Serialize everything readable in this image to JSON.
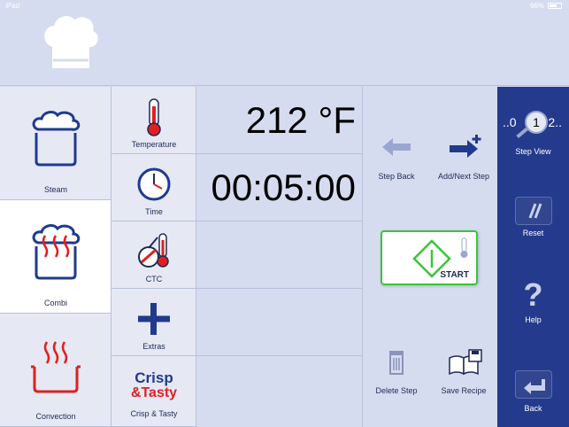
{
  "status": {
    "carrier": "iPad",
    "time": "",
    "battery": "66%"
  },
  "header": {
    "icon": "chef-hat-icon"
  },
  "modes": [
    {
      "label": "Steam",
      "icon": "steam-pot-icon",
      "active": false
    },
    {
      "label": "Combi",
      "icon": "combi-pot-icon",
      "active": true
    },
    {
      "label": "Convection",
      "icon": "convection-pot-icon",
      "active": false
    }
  ],
  "params": [
    {
      "label": "Temperature",
      "icon": "thermometer-icon",
      "value": "212 °F"
    },
    {
      "label": "Time",
      "icon": "clock-icon",
      "value": "00:05:00"
    },
    {
      "label": "CTC",
      "icon": "ctc-icon",
      "value": ""
    },
    {
      "label": "Extras",
      "icon": "plus-icon",
      "value": ""
    },
    {
      "label": "Crisp & Tasty",
      "icon": "crisp-tasty-icon",
      "value": "",
      "logo_line1": "Crisp",
      "logo_line2": "&Tasty"
    }
  ],
  "actions": {
    "step_back": "Step Back",
    "add_next_step": "Add/Next Step",
    "start": "START",
    "delete_step": "Delete Step",
    "save_recipe": "Save Recipe"
  },
  "sidebar": {
    "step_view": {
      "label": "Step View",
      "left": "..0",
      "current": "1",
      "right": "2.."
    },
    "reset": "Reset",
    "help": "Help",
    "back": "Back"
  },
  "colors": {
    "sidebar_bg": "#243a8c",
    "accent_blue": "#1f3a8f",
    "red": "#e02020",
    "start_green": "#3ac43a"
  }
}
